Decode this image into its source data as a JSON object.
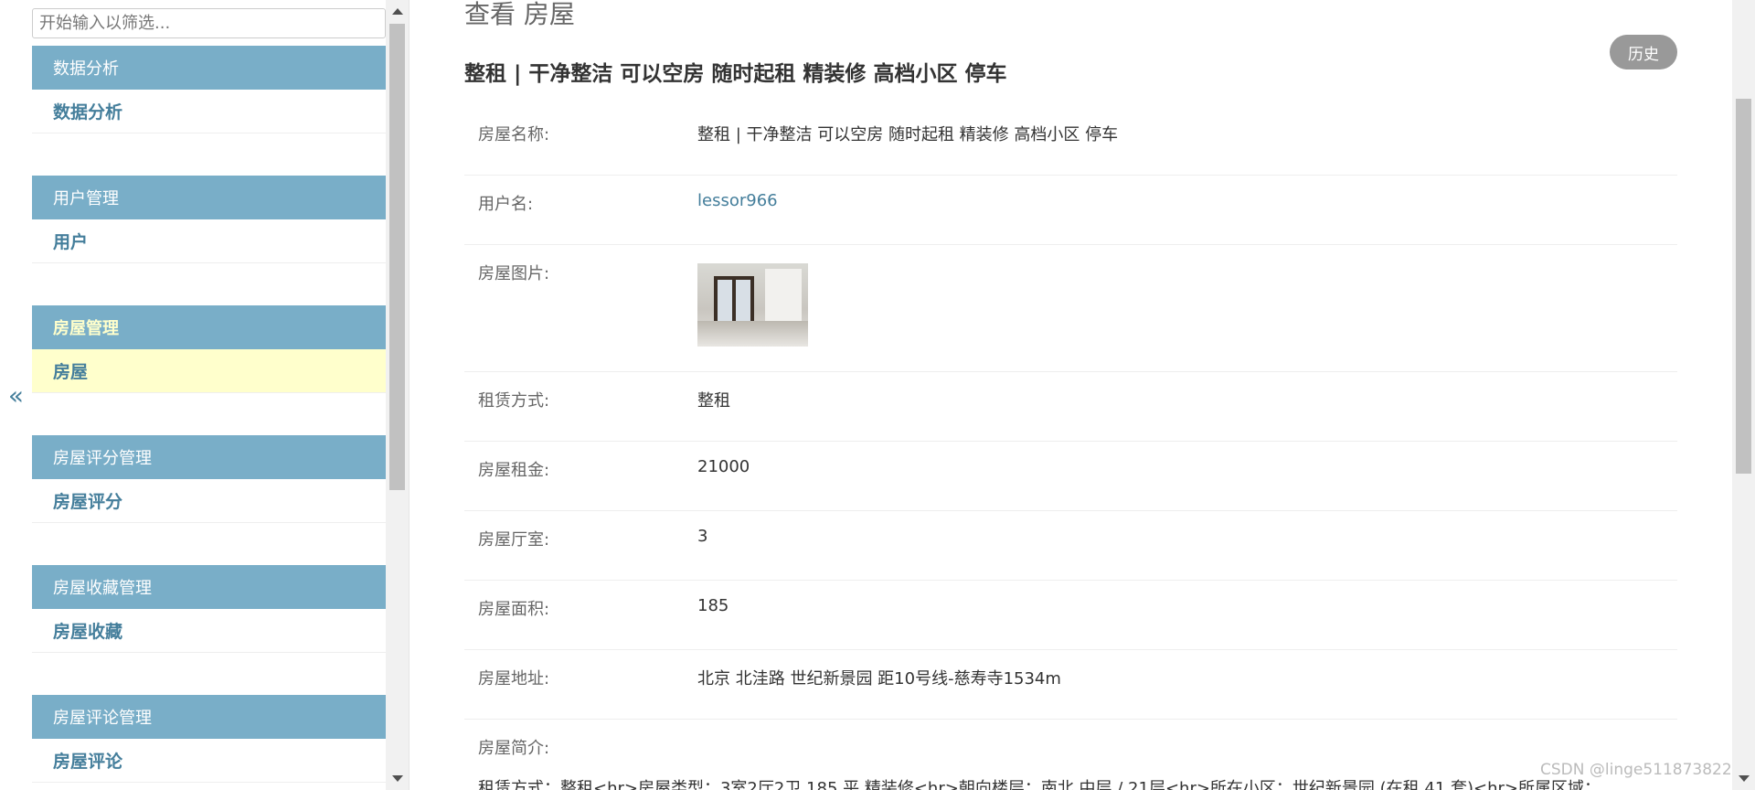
{
  "sidebar": {
    "collapse_icon": "«",
    "filter_placeholder": "开始输入以筛选...",
    "modules": [
      {
        "header": "数据分析",
        "item": "数据分析",
        "active": false
      },
      {
        "header": "用户管理",
        "item": "用户",
        "active": false
      },
      {
        "header": "房屋管理",
        "item": "房屋",
        "active": true
      },
      {
        "header": "房屋评分管理",
        "item": "房屋评分",
        "active": false
      },
      {
        "header": "房屋收藏管理",
        "item": "房屋收藏",
        "active": false
      },
      {
        "header": "房屋评论管理",
        "item": "房屋评论",
        "active": false
      }
    ]
  },
  "main": {
    "page_title": "查看 房屋",
    "history_label": "历史",
    "object_heading": "整租 | 干净整洁 可以空房 随时起租 精装修 高档小区 停车",
    "fields": [
      {
        "label": "房屋名称:",
        "value": "整租 | 干净整洁 可以空房 随时起租 精装修 高档小区 停车"
      },
      {
        "label": "用户名:",
        "value": "lessor966"
      },
      {
        "label": "房屋图片:",
        "value": ""
      },
      {
        "label": "租赁方式:",
        "value": "整租"
      },
      {
        "label": "房屋租金:",
        "value": "21000"
      },
      {
        "label": "房屋厅室:",
        "value": "3"
      },
      {
        "label": "房屋面积:",
        "value": "185"
      },
      {
        "label": "房屋地址:",
        "value": "北京 北洼路 世纪新景园 距10号线-慈寿寺1534m"
      },
      {
        "label": "房屋简介:",
        "value": ""
      }
    ],
    "description_text": "租赁方式：整租<hr>房屋类型：3室2厅2卫 185 平 精装修<hr>朝向楼层：南北 中层 / 21层<hr>所在小区：世纪新景园 (在租 41 套)<hr>所属区域：",
    "thumbnail_icon": "room-photo"
  },
  "watermark": "CSDN @linge511873822",
  "colors": {
    "module_header_bg": "#79aec8",
    "link": "#447e9b",
    "active_row_bg": "#ffffcc",
    "history_button_bg": "#999999"
  }
}
